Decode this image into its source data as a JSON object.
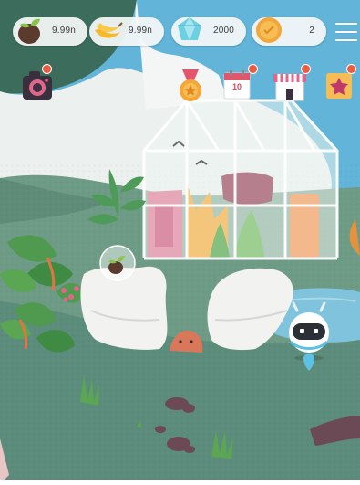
{
  "hud": {
    "seeds": {
      "value": "9.99n",
      "icon": "seed-icon"
    },
    "bananas": {
      "value": "9.99n",
      "icon": "banana-icon"
    },
    "gems": {
      "value": "2000",
      "icon": "diamond-icon"
    },
    "coins": {
      "value": "2",
      "icon": "coin-icon"
    },
    "menu_icon": "hamburger-menu-icon"
  },
  "toolbar": {
    "camera_icon": "camera-icon",
    "medal_icon": "medal-icon",
    "calendar_icon": "calendar-icon",
    "calendar_day": "10",
    "shop_icon": "shop-icon",
    "favorites_icon": "star-icon"
  },
  "scene": {
    "seed_bubble_icon": "seed-icon",
    "robot": "robot-helper",
    "critter": "blob-creature"
  },
  "colors": {
    "sky": "#62b5d8",
    "dark_green": "#3c6d5c",
    "meadow": "#6e9b85",
    "ground": "#5c8c7b",
    "badge": "#ee5a3e"
  }
}
